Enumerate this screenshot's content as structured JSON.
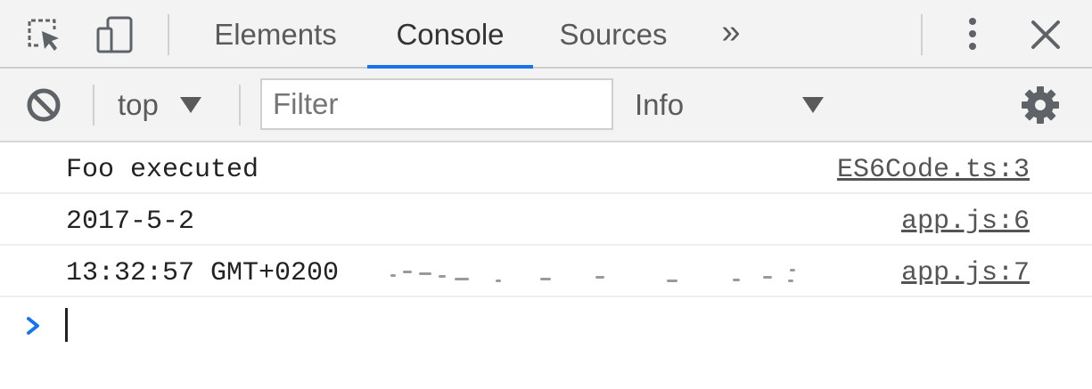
{
  "tabbar": {
    "icons": {
      "inspect": "inspect-element-icon",
      "device": "device-toolbar-icon",
      "more_tabs": "chevron-double-right-icon",
      "menu": "vertical-ellipsis-icon",
      "close": "close-icon"
    },
    "tabs": [
      {
        "label": "Elements",
        "active": false
      },
      {
        "label": "Console",
        "active": true
      },
      {
        "label": "Sources",
        "active": false
      }
    ],
    "more_tabs_glyph": "»",
    "accent_color": "#1a73e8"
  },
  "toolbar": {
    "clear_icon": "clear-console-icon",
    "context": "top",
    "filter_placeholder": "Filter",
    "filter_value": "",
    "level": "Info",
    "settings_icon": "gear-icon"
  },
  "messages": [
    {
      "text": "Foo executed",
      "source": "ES6Code.ts:3"
    },
    {
      "text": "2017-5-2",
      "source": "app.js:6"
    },
    {
      "text": "13:32:57 GMT+0200",
      "source": "app.js:7",
      "redacted": true
    }
  ],
  "prompt": {
    "icon": "prompt-chevron-icon",
    "input_value": ""
  }
}
